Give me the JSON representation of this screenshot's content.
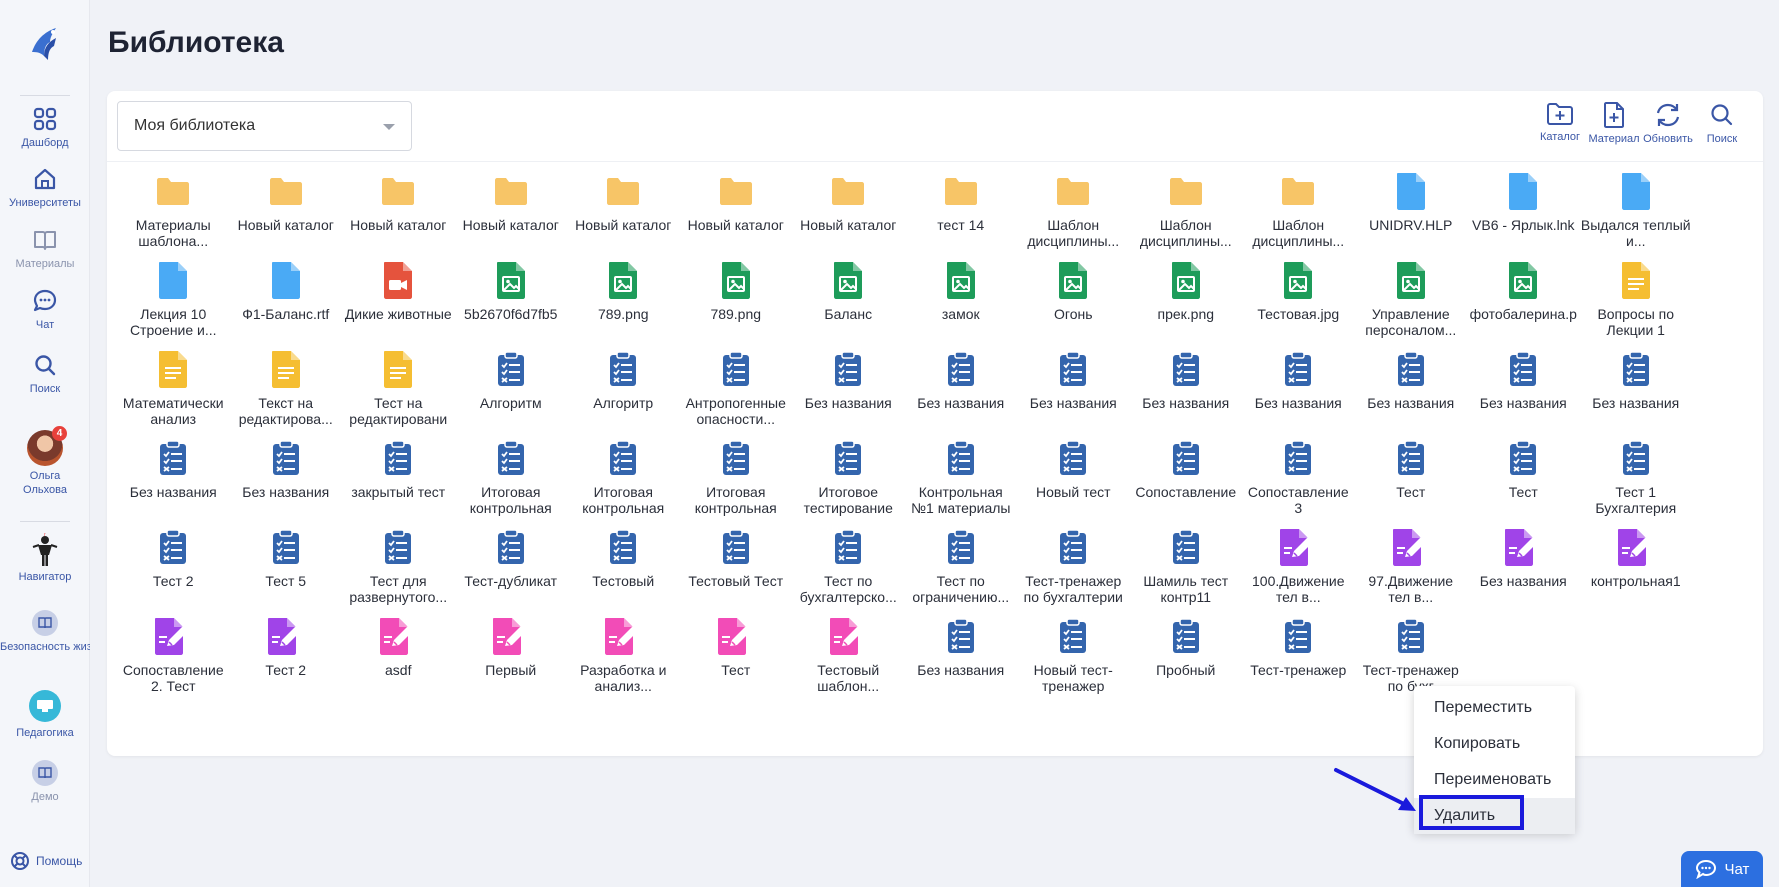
{
  "page": {
    "title": "Библиотека"
  },
  "sidebar": {
    "items": [
      {
        "label": "Дашборд",
        "icon": "grid-icon"
      },
      {
        "label": "Университеты",
        "icon": "home-icon"
      },
      {
        "label": "Материалы",
        "icon": "book-icon"
      },
      {
        "label": "Чат",
        "icon": "chat-icon"
      },
      {
        "label": "Поиск",
        "icon": "search-icon"
      },
      {
        "label": "Ольга Ольхова",
        "icon": "avatar",
        "badge": "4"
      },
      {
        "label": "Навигатор",
        "icon": "navigator-icon"
      },
      {
        "label": "Безопасность жизнедеятельн",
        "icon": "course-icon"
      },
      {
        "label": "Педагогика",
        "icon": "course-icon"
      },
      {
        "label": "Демо",
        "icon": "course-icon"
      }
    ],
    "help": "Помощь"
  },
  "library": {
    "select_value": "Моя библиотека",
    "tools": [
      {
        "label": "Каталог",
        "icon": "folder-plus-icon"
      },
      {
        "label": "Материал",
        "icon": "file-plus-icon"
      },
      {
        "label": "Обновить",
        "icon": "refresh-icon"
      },
      {
        "label": "Поиск",
        "icon": "search-icon"
      }
    ],
    "items": [
      {
        "name": "Материалы шаблона...",
        "type": "folder"
      },
      {
        "name": "Новый каталог",
        "type": "folder"
      },
      {
        "name": "Новый каталог",
        "type": "folder"
      },
      {
        "name": "Новый каталог",
        "type": "folder"
      },
      {
        "name": "Новый каталог",
        "type": "folder"
      },
      {
        "name": "Новый каталог",
        "type": "folder"
      },
      {
        "name": "Новый каталог",
        "type": "folder"
      },
      {
        "name": "тест 14",
        "type": "folder"
      },
      {
        "name": "Шаблон дисциплины...",
        "type": "folder"
      },
      {
        "name": "Шаблон дисциплины...",
        "type": "folder"
      },
      {
        "name": "Шаблон дисциплины...",
        "type": "folder"
      },
      {
        "name": "UNIDRV.HLP",
        "type": "file-blue"
      },
      {
        "name": "VB6 - Ярлык.lnk",
        "type": "file-blue"
      },
      {
        "name": "Выдался теплый и...",
        "type": "file-blue"
      },
      {
        "name": "Лекция 10 Строение и...",
        "type": "file-blue"
      },
      {
        "name": "Ф1-Баланс.rtf",
        "type": "file-blue"
      },
      {
        "name": "Дикие животные",
        "type": "video"
      },
      {
        "name": "5b2670f6d7fb5",
        "type": "image"
      },
      {
        "name": "789.png",
        "type": "image"
      },
      {
        "name": "789.png",
        "type": "image"
      },
      {
        "name": "Баланс",
        "type": "image"
      },
      {
        "name": "замок",
        "type": "image"
      },
      {
        "name": "Огонь",
        "type": "image"
      },
      {
        "name": "прек.png",
        "type": "image"
      },
      {
        "name": "Тестовая.jpg",
        "type": "image"
      },
      {
        "name": "Управление персоналом...",
        "type": "image"
      },
      {
        "name": "фотобалерина.р",
        "type": "image"
      },
      {
        "name": "Вопросы по Лекции 1",
        "type": "doc"
      },
      {
        "name": "Математически анализ",
        "type": "doc"
      },
      {
        "name": "Текст на редактирова...",
        "type": "doc"
      },
      {
        "name": "Тест на редактировани",
        "type": "doc"
      },
      {
        "name": "Алгоритм",
        "type": "test"
      },
      {
        "name": "Алгоритр",
        "type": "test"
      },
      {
        "name": "Антропогенные опасности...",
        "type": "test"
      },
      {
        "name": "Без названия",
        "type": "test"
      },
      {
        "name": "Без названия",
        "type": "test"
      },
      {
        "name": "Без названия",
        "type": "test"
      },
      {
        "name": "Без названия",
        "type": "test"
      },
      {
        "name": "Без названия",
        "type": "test"
      },
      {
        "name": "Без названия",
        "type": "test"
      },
      {
        "name": "Без названия",
        "type": "test"
      },
      {
        "name": "Без названия",
        "type": "test"
      },
      {
        "name": "Без названия",
        "type": "test"
      },
      {
        "name": "Без названия",
        "type": "test"
      },
      {
        "name": "закрытый тест",
        "type": "test"
      },
      {
        "name": "Итоговая контрольная",
        "type": "test"
      },
      {
        "name": "Итоговая контрольная",
        "type": "test"
      },
      {
        "name": "Итоговая контрольная",
        "type": "test"
      },
      {
        "name": "Итоговое тестирование",
        "type": "test"
      },
      {
        "name": "Контрольная №1 материалы",
        "type": "test"
      },
      {
        "name": "Новый тест",
        "type": "test"
      },
      {
        "name": "Сопоставление",
        "type": "test"
      },
      {
        "name": "Сопоставление 3",
        "type": "test"
      },
      {
        "name": "Тест",
        "type": "test"
      },
      {
        "name": "Тест",
        "type": "test"
      },
      {
        "name": "Тест 1 Бухгалтерия",
        "type": "test"
      },
      {
        "name": "Тест 2",
        "type": "test"
      },
      {
        "name": "Тест 5",
        "type": "test"
      },
      {
        "name": "Тест для развернутого...",
        "type": "test"
      },
      {
        "name": "Тест-дубликат",
        "type": "test"
      },
      {
        "name": "Тестовый",
        "type": "test"
      },
      {
        "name": "Тестовый Тест",
        "type": "test"
      },
      {
        "name": "Тест по бухгалтерско...",
        "type": "test"
      },
      {
        "name": "Тест по ограничению...",
        "type": "test"
      },
      {
        "name": "Тест-тренажер по бухгалтерии",
        "type": "test"
      },
      {
        "name": "Шамиль тест контр11",
        "type": "test"
      },
      {
        "name": "100.Движение тел в...",
        "type": "task-purple"
      },
      {
        "name": "97.Движение тел в...",
        "type": "task-purple"
      },
      {
        "name": "Без названия",
        "type": "task-purple"
      },
      {
        "name": "контрольная1",
        "type": "task-purple"
      },
      {
        "name": "Сопоставление 2. Тест",
        "type": "task-purple"
      },
      {
        "name": "Тест 2",
        "type": "task-purple"
      },
      {
        "name": "asdf",
        "type": "task-pink"
      },
      {
        "name": "Первый",
        "type": "task-pink"
      },
      {
        "name": "Разработка и анализ...",
        "type": "task-pink"
      },
      {
        "name": "Тест",
        "type": "task-pink"
      },
      {
        "name": "Тестовый шаблон...",
        "type": "task-pink"
      },
      {
        "name": "Без названия",
        "type": "test"
      },
      {
        "name": "Новый тест-тренажер",
        "type": "test"
      },
      {
        "name": "Пробный",
        "type": "test"
      },
      {
        "name": "Тест-тренажер",
        "type": "test"
      },
      {
        "name": "Тест-тренажер по бухг",
        "type": "test"
      }
    ]
  },
  "context_menu": {
    "items": [
      "Переместить",
      "Копировать",
      "Переименовать",
      "Удалить"
    ],
    "highlighted": "Удалить"
  },
  "chat_button": {
    "label": "Чат"
  },
  "colors": {
    "accent": "#3a56a6",
    "folder": "#f7c567",
    "file_blue": "#4aaaf5",
    "image_green": "#1e9c5a",
    "video_red": "#e5533d",
    "doc_yellow": "#f5be32",
    "test_blue": "#3465ad",
    "task_purple": "#a044e8",
    "task_pink": "#f24cb7",
    "highlight": "#1a1adc"
  }
}
